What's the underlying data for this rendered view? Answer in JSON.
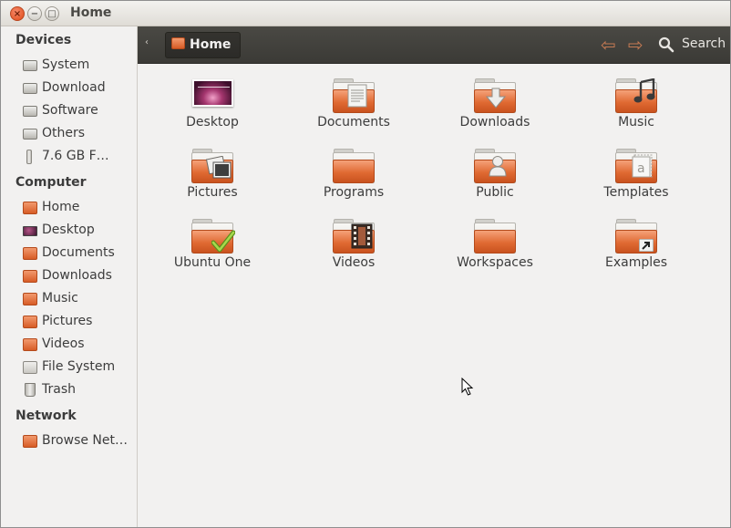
{
  "window": {
    "title": "Home",
    "close_glyph": "×",
    "minimize_glyph": "−",
    "maximize_glyph": "□"
  },
  "sidebar": {
    "sections": [
      {
        "heading": "Devices",
        "items": [
          {
            "label": "System",
            "icon": "drive-icon"
          },
          {
            "label": "Download",
            "icon": "drive-icon"
          },
          {
            "label": "Software",
            "icon": "drive-icon"
          },
          {
            "label": "Others",
            "icon": "drive-icon"
          },
          {
            "label": "7.6 GB F…",
            "icon": "usb-drive-icon"
          }
        ]
      },
      {
        "heading": "Computer",
        "items": [
          {
            "label": "Home",
            "icon": "home-folder-icon"
          },
          {
            "label": "Desktop",
            "icon": "desktop-icon"
          },
          {
            "label": "Documents",
            "icon": "documents-folder-icon"
          },
          {
            "label": "Downloads",
            "icon": "downloads-folder-icon"
          },
          {
            "label": "Music",
            "icon": "music-folder-icon"
          },
          {
            "label": "Pictures",
            "icon": "pictures-folder-icon"
          },
          {
            "label": "Videos",
            "icon": "videos-folder-icon"
          },
          {
            "label": "File System",
            "icon": "file-system-icon"
          },
          {
            "label": "Trash",
            "icon": "trash-icon"
          }
        ]
      },
      {
        "heading": "Network",
        "items": [
          {
            "label": "Browse Net…",
            "icon": "network-icon"
          }
        ]
      }
    ]
  },
  "toolbar": {
    "back_glyph": "‹",
    "breadcrumb": "Home",
    "nav_back_glyph": "⇦",
    "nav_forward_glyph": "⇨",
    "search_label": "Search"
  },
  "files": [
    {
      "label": "Desktop",
      "icon": "desktop-thumbnail-icon",
      "emblem": ""
    },
    {
      "label": "Documents",
      "icon": "documents-folder-icon",
      "emblem": "📄"
    },
    {
      "label": "Downloads",
      "icon": "downloads-folder-icon",
      "emblem": "⬇"
    },
    {
      "label": "Music",
      "icon": "music-folder-icon",
      "emblem": "♫"
    },
    {
      "label": "Pictures",
      "icon": "pictures-folder-icon",
      "emblem": "▣"
    },
    {
      "label": "Programs",
      "icon": "folder-icon",
      "emblem": ""
    },
    {
      "label": "Public",
      "icon": "public-folder-icon",
      "emblem": "👤"
    },
    {
      "label": "Templates",
      "icon": "templates-folder-icon",
      "emblem": "a"
    },
    {
      "label": "Ubuntu One",
      "icon": "ubuntu-one-folder-icon",
      "emblem": "✔"
    },
    {
      "label": "Videos",
      "icon": "videos-folder-icon",
      "emblem": "▦"
    },
    {
      "label": "Workspaces",
      "icon": "folder-icon",
      "emblem": ""
    },
    {
      "label": "Examples",
      "icon": "examples-folder-icon",
      "emblem": "➚"
    }
  ],
  "colors": {
    "accent": "#e06a33",
    "toolbar": "#3b3a36",
    "background": "#f2f1f0"
  }
}
